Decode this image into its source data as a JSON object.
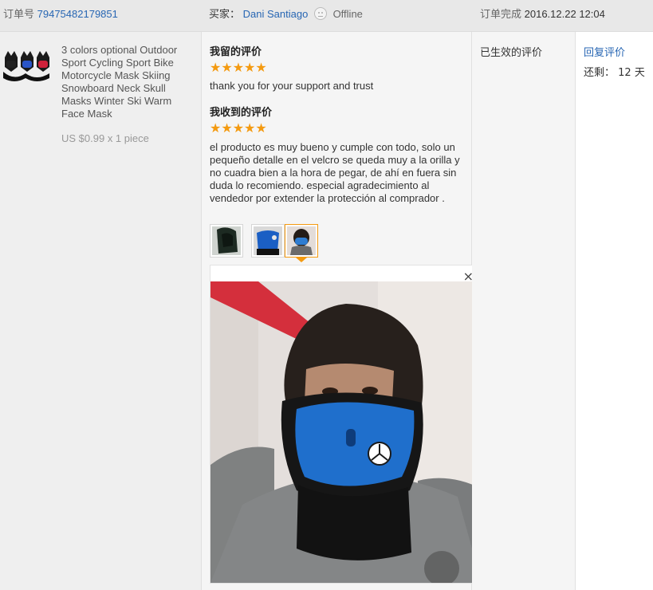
{
  "header": {
    "order_label": "订单号",
    "order_number": "79475482179851",
    "buyer_label": "买家：",
    "buyer_name": "Dani Santiago",
    "buyer_status": "Offline",
    "completed_label": "订单完成",
    "completed_time": "2016.12.22 12:04"
  },
  "product": {
    "title": "3 colors optional Outdoor Sport Cycling Sport Bike Motorcycle Mask Skiing Snowboard Neck Skull Masks Winter Ski Warm Face Mask",
    "price_line": "US $0.99 x 1 piece",
    "thumbnail_icon": "ski-mask-product-image"
  },
  "review": {
    "left_label": "我留的评价",
    "left_rating": 5,
    "left_text": "thank you for your support and trust",
    "received_label": "我收到的评价",
    "received_rating": 5,
    "received_text": "el producto es muy bueno y cumple con todo, solo un pequeño detalle en el velcro se queda muy a la orilla y no cuadra bien a la hora de pegar, de ahí en fuera sin duda lo recomiendo. especial agradecimiento al vendedor por extender la protección al comprador .",
    "star_glyph": "★",
    "star_color": "#f49a10",
    "photos": [
      {
        "icon": "photo-thumb-dark-mask"
      },
      {
        "icon": "photo-thumb-blue-mask"
      },
      {
        "icon": "photo-thumb-face-mask",
        "selected": true
      }
    ],
    "close_glyph": "×"
  },
  "status": {
    "text": "已生效的评价"
  },
  "actions": {
    "reply_label": "回复评价",
    "remain_label": "还剩：",
    "remain_value": "12 天"
  },
  "colors": {
    "link_blue": "#2766b3",
    "accent_orange": "#f49a10"
  }
}
